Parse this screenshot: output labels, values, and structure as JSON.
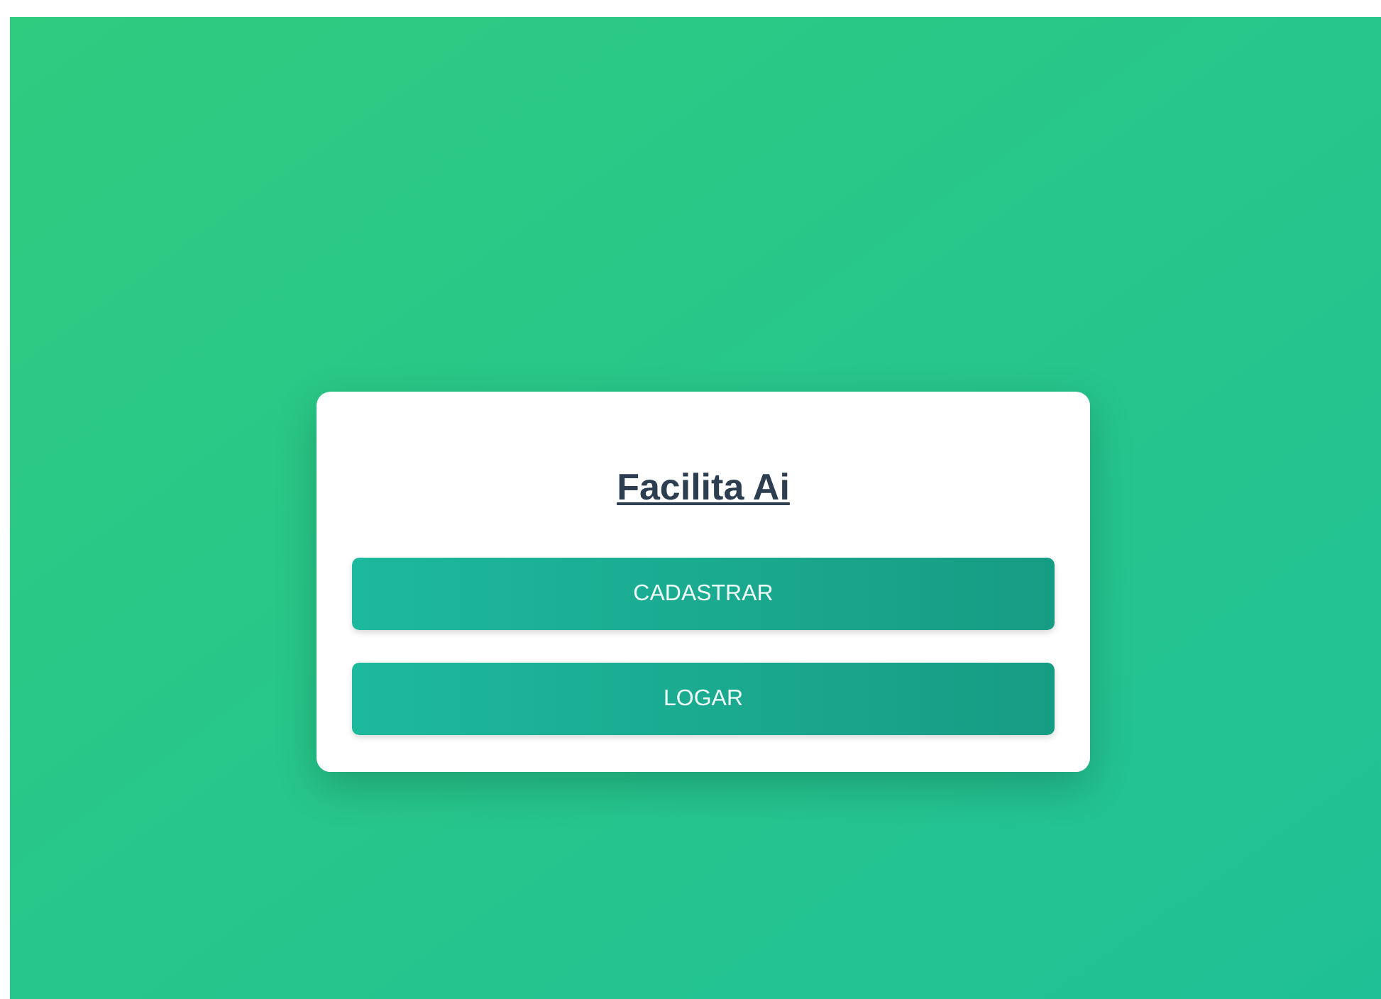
{
  "title": "Facilita Ai",
  "buttons": [
    "CADASTRAR",
    "LOGAR"
  ]
}
